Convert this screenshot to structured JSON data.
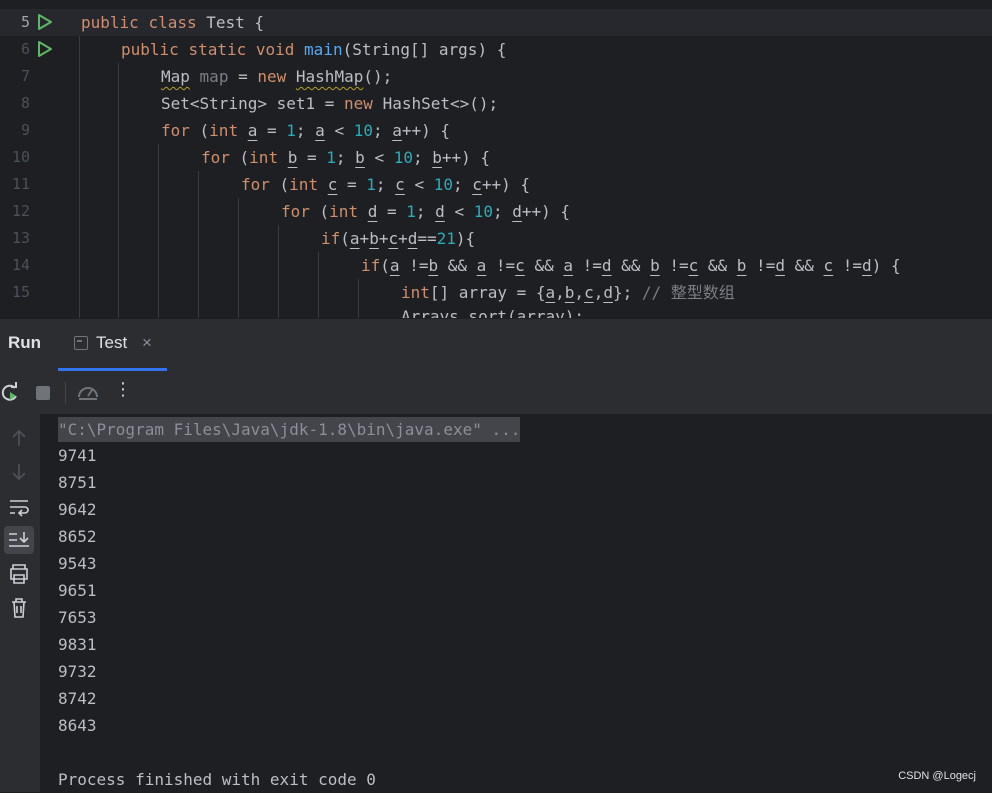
{
  "editor": {
    "line_numbers": [
      "5",
      "6",
      "7",
      "8",
      "9",
      "10",
      "11",
      "12",
      "13",
      "14",
      "15"
    ],
    "lines": {
      "l5": {
        "kw1": "public",
        "kw2": "class",
        "name": "Test",
        "rest": " {"
      },
      "l6": {
        "kw1": "public",
        "kw2": "static",
        "kw3": "void",
        "fn": "main",
        "rest": "(String[] args) {"
      },
      "l7": {
        "type": "Map",
        "var": "map",
        "eq": " = ",
        "kw": "new",
        "cls": "HashMap",
        "rest": "();"
      },
      "l8": {
        "pre": "Set<String> set1 = ",
        "kw": "new",
        "rest": " HashSet<>();"
      },
      "l9": {
        "kw": "for",
        "p1": " (",
        "kw2": "int",
        "a": "a",
        "p2": " = ",
        "n1": "1",
        "p3": "; ",
        "a2": "a",
        "p4": " < ",
        "n2": "10",
        "p5": "; ",
        "a3": "a",
        "p6": "++) {"
      },
      "l10": {
        "kw": "for",
        "p1": " (",
        "kw2": "int",
        "a": "b",
        "p2": " = ",
        "n1": "1",
        "p3": "; ",
        "a2": "b",
        "p4": " < ",
        "n2": "10",
        "p5": "; ",
        "a3": "b",
        "p6": "++) {"
      },
      "l11": {
        "kw": "for",
        "p1": " (",
        "kw2": "int",
        "a": "c",
        "p2": " = ",
        "n1": "1",
        "p3": "; ",
        "a2": "c",
        "p4": " < ",
        "n2": "10",
        "p5": "; ",
        "a3": "c",
        "p6": "++) {"
      },
      "l12": {
        "kw": "for",
        "p1": " (",
        "kw2": "int",
        "a": "d",
        "p2": " = ",
        "n1": "1",
        "p3": "; ",
        "a2": "d",
        "p4": " < ",
        "n2": "10",
        "p5": "; ",
        "a3": "d",
        "p6": "++) {"
      },
      "l13": {
        "kw": "if",
        "p1": "(",
        "a": "a",
        "p2": "+",
        "b": "b",
        "p3": "+",
        "c": "c",
        "p4": "+",
        "d": "d",
        "p5": "==",
        "n": "21",
        "p6": "){"
      },
      "l14": {
        "kw": "if",
        "p1": "(",
        "v1": "a",
        "o1": " !=",
        "v2": "b",
        "o2": " && ",
        "v3": "a",
        "o3": " !=",
        "v4": "c",
        "o4": " && ",
        "v5": "a",
        "o5": " !=",
        "v6": "d",
        "o6": " && ",
        "v7": "b",
        "o7": " !=",
        "v8": "c",
        "o8": " && ",
        "v9": "b",
        "o9": " !=",
        "v10": "d",
        "o10": " && ",
        "v11": "c",
        "o11": " !=",
        "v12": "d",
        "o12": ") {"
      },
      "l15": {
        "kw": "int",
        "p1": "[] array = {",
        "v1": "a",
        "c1": ",",
        "v2": "b",
        "c2": ",",
        "v3": "c",
        "c3": ",",
        "v4": "d",
        "p2": "}; ",
        "cmt": "// 整型数组"
      },
      "l16": {
        "text": "Arrays.sort(array);"
      }
    }
  },
  "run_panel": {
    "title": "Run",
    "tab_label": "Test",
    "tab_close": "×",
    "more": "⋮"
  },
  "console": {
    "command": "\"C:\\Program Files\\Java\\jdk-1.8\\bin\\java.exe\" ...",
    "outputs": [
      "9741",
      "8751",
      "9642",
      "8652",
      "9543",
      "9651",
      "7653",
      "9831",
      "9732",
      "8742",
      "8643"
    ],
    "finish": "Process finished with exit code 0"
  },
  "watermark": "CSDN @Logecj"
}
